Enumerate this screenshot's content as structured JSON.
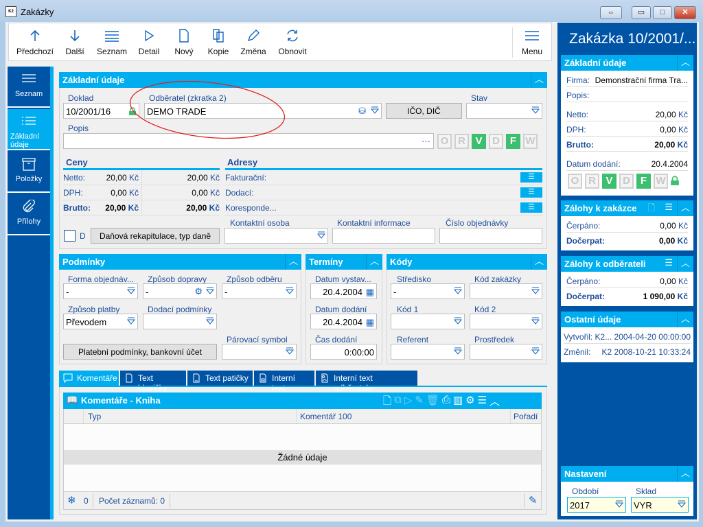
{
  "window": {
    "title": "Zakázky",
    "controls": [
      "⇔",
      "▭",
      "□",
      "✕"
    ]
  },
  "toolbar": {
    "items": [
      {
        "label": "Předchozí",
        "icon": "arrow-up-icon"
      },
      {
        "label": "Další",
        "icon": "arrow-down-icon"
      },
      {
        "label": "Seznam",
        "icon": "list-icon"
      },
      {
        "label": "Detail",
        "icon": "play-icon"
      },
      {
        "label": "Nový",
        "icon": "new-document-icon"
      },
      {
        "label": "Kopie",
        "icon": "copy-icon"
      },
      {
        "label": "Změna",
        "icon": "pencil-icon"
      },
      {
        "label": "Obnovit",
        "icon": "refresh-icon"
      }
    ],
    "menu_label": "Menu"
  },
  "nav": {
    "items": [
      {
        "label": "Seznam"
      },
      {
        "label": "Základní údaje",
        "active": true
      },
      {
        "label": "Položky"
      },
      {
        "label": "Přílohy"
      }
    ]
  },
  "basic": {
    "title": "Základní údaje",
    "doklad_label": "Doklad",
    "doklad_value": "10/2001/16",
    "odberatel_label": "Odběratel (zkratka 2)",
    "odberatel_value": "DEMO TRADE",
    "ico_button": "IČO, DIČ",
    "stav_label": "Stav",
    "stav_value": "",
    "popis_label": "Popis",
    "popis_value": "",
    "popis_more": "···",
    "flags": [
      {
        "l": "O",
        "on": false
      },
      {
        "l": "R",
        "on": false
      },
      {
        "l": "V",
        "on": true
      },
      {
        "l": "D",
        "on": false
      },
      {
        "l": "F",
        "on": true
      },
      {
        "l": "W",
        "on": false
      }
    ],
    "ceny": {
      "title": "Ceny",
      "rows": [
        {
          "label": "Netto:",
          "v1": "20,00",
          "v2": "20,00"
        },
        {
          "label": "DPH:",
          "v1": "0,00",
          "v2": "0,00"
        },
        {
          "label": "Brutto:",
          "v1": "20,00",
          "v2": "20,00",
          "bold": true
        }
      ],
      "currency": "Kč"
    },
    "adresy": {
      "title": "Adresy",
      "rows": [
        "Fakturační:",
        "Dodací:",
        "Koresponde..."
      ]
    },
    "kontaktni_osoba_label": "Kontaktní osoba",
    "kontaktni_info_label": "Kontaktní informace",
    "cislo_obj_label": "Číslo objednávky",
    "d_checkbox_label": "D",
    "d_checked": false,
    "dan_button": "Daňová rekapitulace, typ daně"
  },
  "podminky": {
    "title": "Podmínky",
    "forma_label": "Forma objednáv...",
    "forma_value": "-",
    "doprava_label": "Způsob dopravy",
    "doprava_value": "-",
    "odber_label": "Způsob odběru",
    "odber_value": "-",
    "platba_label": "Způsob platby",
    "platba_value": "Převodem",
    "dodaci_label": "Dodací podmínky",
    "dodaci_value": "",
    "parovaci_label": "Párovací symbol",
    "parovaci_value": "",
    "platebni_button": "Platební podmínky, bankovní účet"
  },
  "terminy": {
    "title": "Termíny",
    "vystaveni_label": "Datum vystav...",
    "vystaveni_value": "20.4.2004",
    "dodani_label": "Datum dodání",
    "dodani_value": "20.4.2004",
    "cas_label": "Čas dodání",
    "cas_value": "0:00:00"
  },
  "kody": {
    "title": "Kódy",
    "stredisko_label": "Středisko",
    "stredisko_value": "-",
    "kod_zakazky_label": "Kód zakázky",
    "kod1_label": "Kód 1",
    "kod2_label": "Kód 2",
    "referent_label": "Referent",
    "prostredek_label": "Prostředek"
  },
  "tabs": [
    {
      "label": "Komentáře",
      "active": true
    },
    {
      "label": "Text hlavičky"
    },
    {
      "label": "Text patičky"
    },
    {
      "label": "Interní text"
    },
    {
      "label": "Interní text odběratele"
    }
  ],
  "grid": {
    "title": "Komentáře - Kniha",
    "columns": [
      "Typ",
      "Komentář 100",
      "Pořadí"
    ],
    "empty": "Žádné údaje",
    "filter_count": "0",
    "record_count": "Počet záznamů: 0"
  },
  "right": {
    "title": "Zakázka 10/2001/...",
    "basic": {
      "title": "Základní údaje",
      "firma_label": "Firma:",
      "firma_value": "Demonstrační firma Tra...",
      "popis_label": "Popis:",
      "netto_label": "Netto:",
      "netto_value": "20,00",
      "dph_label": "DPH:",
      "dph_value": "0,00",
      "brutto_label": "Brutto:",
      "brutto_value": "20,00",
      "datum_label": "Datum dodání:",
      "datum_value": "20.4.2004",
      "currency": "Kč"
    },
    "zalohy_zakazka": {
      "title": "Zálohy k zakázce",
      "cerpano_label": "Čerpáno:",
      "cerpano_value": "0,00",
      "docerpat_label": "Dočerpat:",
      "docerpat_value": "0,00"
    },
    "zalohy_odberatel": {
      "title": "Zálohy k odběrateli",
      "cerpano_label": "Čerpáno:",
      "cerpano_value": "0,00",
      "docerpat_label": "Dočerpat:",
      "docerpat_value": "1 090,00"
    },
    "ostatni": {
      "title": "Ostatní údaje",
      "vytvoril_label": "Vytvořil:",
      "vytvoril_value": "K2... 2004-04-20 00:00:00",
      "zmenil_label": "Změnil:",
      "zmenil_value": "K2 2008-10-21 10:33:24"
    },
    "nastaveni": {
      "title": "Nastavení",
      "obdobi_label": "Období",
      "obdobi_value": "2017",
      "sklad_label": "Sklad",
      "sklad_value": "VYR"
    }
  },
  "colors": {
    "accent": "#00aeef",
    "navy": "#0054a6",
    "flag_on": "#3cbf6e",
    "annotation": "#e02020"
  }
}
